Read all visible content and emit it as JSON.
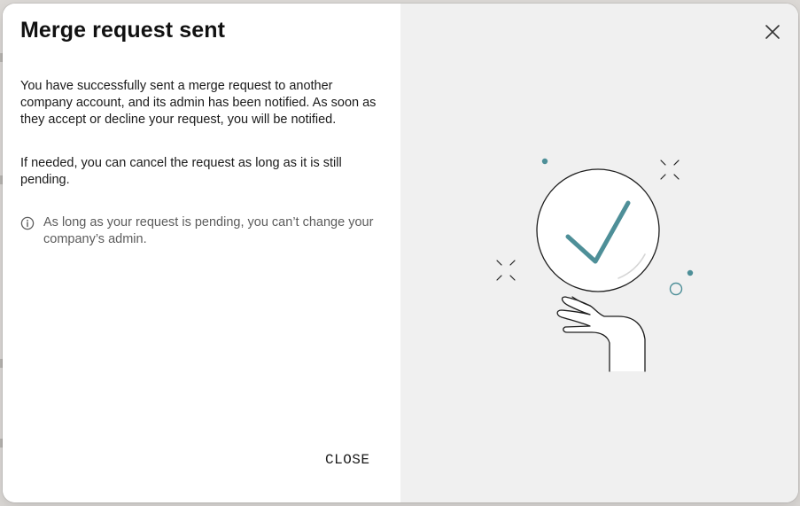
{
  "dialog": {
    "title": "Merge request sent",
    "paragraph_1": "You have successfully sent a merge request to another company account, and its admin has been notified. As soon as they accept or decline your request, you will be notified.",
    "paragraph_2": "If needed, you can cancel the request as long as it is still pending.",
    "info_note": "As long as your request is pending, you can’t change your company’s admin.",
    "close_label": "CLOSE"
  },
  "icons": {
    "info": "info-circle-icon",
    "dismiss": "close-x-icon",
    "illustration": "checkmark-in-hand-illustration"
  },
  "colors": {
    "accent_teal": "#4e8f98",
    "right_panel_bg": "#f0f0f0",
    "text_primary": "#1a1a1a",
    "text_muted": "#5c5c5c"
  }
}
